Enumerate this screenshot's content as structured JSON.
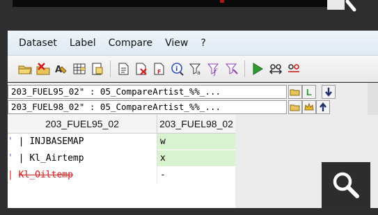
{
  "menu": [
    "Dataset",
    "Label",
    "Compare",
    "View",
    "?"
  ],
  "toolbar_icons": [
    "open-folder-icon",
    "edit-folder-icon",
    "label-icon",
    "grid-icon",
    "export-icon",
    "document-icon",
    "delete-document-icon",
    "filter-document-icon",
    "info-icon",
    "filter-icon",
    "filter-function-icon",
    "filter-clear-icon",
    "play-icon",
    "compare-icon",
    "compare-alt-icon"
  ],
  "datasets": {
    "combo1": "203_FUEL95_02\" : 05_CompareArtist_%%_...",
    "combo2": "203_FUEL98_02\" : 05_CompareArtist_%%_...",
    "combo1_label_btn": "L"
  },
  "grid": {
    "col1_header": "203_FUEL95_02",
    "col2_header": "203_FUEL98_02",
    "rows": [
      {
        "marker": "'",
        "name": "INJBASEMAP",
        "value": "w"
      },
      {
        "marker": "'",
        "name": "Kl_Airtemp",
        "value": "x"
      },
      {
        "marker": "",
        "name": "Kl_Oiltemp",
        "value": "-"
      }
    ]
  },
  "colors": {
    "accent_green": "#2f9a2f",
    "row_highlight": "#d9f2cf",
    "strike_red": "#d21a1a",
    "menubar": "#e6eff7"
  }
}
